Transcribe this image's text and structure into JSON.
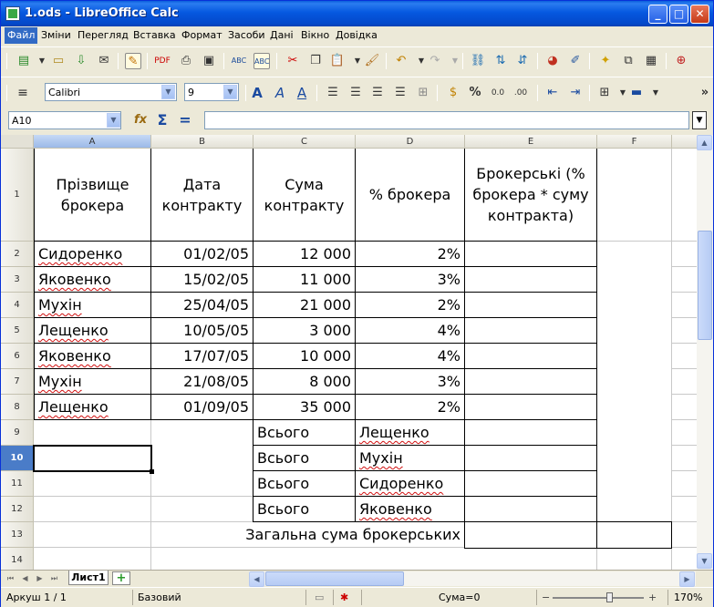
{
  "window": {
    "title": "1.ods - LibreOffice Calc",
    "controls": {
      "minimize": "_",
      "maximize": "□",
      "close": "✕"
    }
  },
  "menu": [
    "Файл",
    "Зміни",
    "Перегляд",
    "Вставка",
    "Формат",
    "Засоби",
    "Дані",
    "Вікно",
    "Довідка"
  ],
  "toolbar_icons": [
    "new-icon",
    "open-icon",
    "save-icon",
    "email-icon",
    "edit-icon",
    "pdf-icon",
    "print-icon",
    "print-preview-icon",
    "spellcheck-icon",
    "autospellcheck-icon",
    "cut-icon",
    "copy-icon",
    "paste-icon",
    "clone-format-icon",
    "undo-icon",
    "redo-icon",
    "hyperlink-icon",
    "sort-ascending-icon",
    "sort-descending-icon",
    "chart-icon",
    "draw-icon",
    "navigator-icon",
    "gallery-icon",
    "datasources-icon",
    "help-icon"
  ],
  "format_bar": {
    "font_name": "Calibri",
    "font_size": "9",
    "currency_label": "%",
    "more": "»"
  },
  "formula_bar": {
    "name_box": "A10",
    "formula": ""
  },
  "columns": [
    "A",
    "B",
    "C",
    "D",
    "E",
    "F"
  ],
  "rows": [
    "1",
    "2",
    "3",
    "4",
    "5",
    "6",
    "7",
    "8",
    "9",
    "10",
    "11",
    "12",
    "13",
    "14"
  ],
  "selected_cell": {
    "column": "A",
    "row": "10"
  },
  "table": {
    "headers": [
      "Прізвище брокера",
      "Дата контракту",
      "Сума контракту",
      "% брокера",
      "Брокерські (% брокера * суму контракта)"
    ],
    "data": [
      [
        "Сидоренко",
        "01/02/05",
        "12 000",
        "2%"
      ],
      [
        "Яковенко",
        "15/02/05",
        "11 000",
        "3%"
      ],
      [
        "Мухін",
        "25/04/05",
        "21 000",
        "2%"
      ],
      [
        "Лещенко",
        "10/05/05",
        "3 000",
        "4%"
      ],
      [
        "Яковенко",
        "17/07/05",
        "10 000",
        "4%"
      ],
      [
        "Мухін",
        "21/08/05",
        "8 000",
        "3%"
      ],
      [
        "Лещенко",
        "01/09/05",
        "35 000",
        "2%"
      ]
    ],
    "totals": [
      [
        "Всього",
        "Лещенко"
      ],
      [
        "Всього",
        "Мухін"
      ],
      [
        "Всього",
        "Сидоренко"
      ],
      [
        "Всього",
        "Яковенко"
      ]
    ],
    "grand_total_label": "Загальна сума брокерських"
  },
  "sheet_tabs": [
    "Лист1"
  ],
  "status": {
    "sheet": "Аркуш 1 / 1",
    "style": "Базовий",
    "sum": "Сума=0",
    "zoom": "170%"
  }
}
